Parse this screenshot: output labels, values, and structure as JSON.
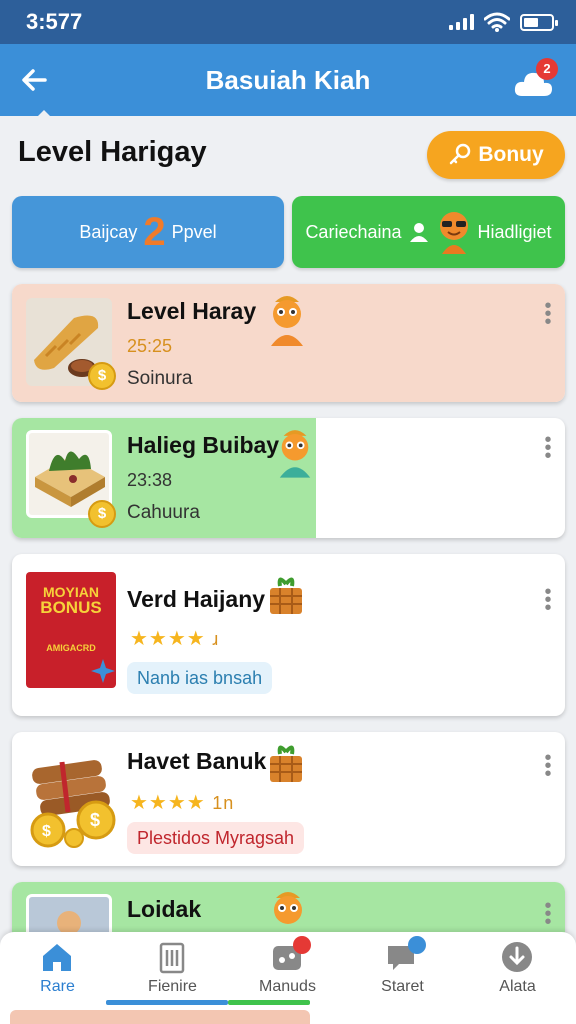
{
  "status_bar": {
    "time": "3:577"
  },
  "header": {
    "title": "Basuiah Kiah",
    "notification_count": "2"
  },
  "section": {
    "title": "Level Harigay",
    "bonus_label": "Bonuy"
  },
  "toggles": {
    "left": {
      "text_before": "Baijcay",
      "number": "2",
      "text_after": "Ppvel"
    },
    "right": {
      "text_before": "Cariechaina",
      "text_after": "Hiadligiet"
    }
  },
  "cards": [
    {
      "title": "Level Haray",
      "time": "25:25",
      "subtitle": "Soinura",
      "fill_color": "#f7d9cb",
      "fill_fraction": 1.0
    },
    {
      "title": "Halieg Buibay",
      "time": "23:38",
      "subtitle": "Cahuura",
      "fill_color": "#a6e6a2",
      "fill_fraction": 0.55
    },
    {
      "title": "Verd Haijany",
      "rating": "★★★★",
      "rating_suffix": "ɹ",
      "thumb_text": [
        "MOYIAN",
        "BONUS",
        "AMIGACRD"
      ],
      "tag": "Nanb ias bnsah",
      "tag_color": "#2c7fb0",
      "tag_bg": "#e4f2fb"
    },
    {
      "title": "Havet Banuk",
      "rating": "★★★★",
      "rating_suffix": "1n",
      "tag": "Plestidos Myragsah",
      "tag_color": "#c0262d",
      "tag_bg": "#fde6e4"
    },
    {
      "title": "Loidak",
      "fill_color": "#a6e6a2"
    }
  ],
  "nav": [
    {
      "label": "Rare",
      "icon": "home-icon",
      "active": true
    },
    {
      "label": "Fienire",
      "icon": "building-icon",
      "active": false
    },
    {
      "label": "Manuds",
      "icon": "gamepad-icon",
      "active": false,
      "badge": ""
    },
    {
      "label": "Staret",
      "icon": "chat-icon",
      "active": false,
      "badge": ""
    },
    {
      "label": "Alata",
      "icon": "download-icon",
      "active": false
    }
  ]
}
